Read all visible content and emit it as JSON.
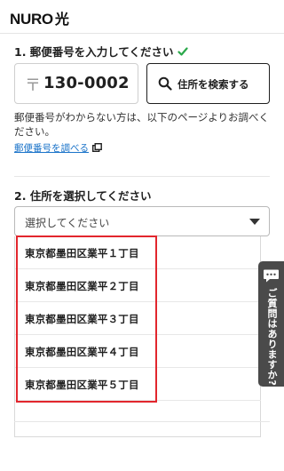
{
  "header": {
    "logo_brand": "NURO",
    "logo_suffix": "光"
  },
  "step1": {
    "title": "1. 郵便番号を入力してください",
    "zip_mark": "〒",
    "zip_value": "130-0002",
    "search_button": "住所を検索する",
    "help_text": "郵便番号がわからない方は、以下のページよりお調べください。",
    "help_link": "郵便番号を調べる"
  },
  "step2": {
    "title": "2. 住所を選択してください",
    "select_placeholder": "選択してください",
    "options": [
      {
        "label": "東京都墨田区業平１丁目"
      },
      {
        "label": "東京都墨田区業平２丁目"
      },
      {
        "label": "東京都墨田区業平３丁目"
      },
      {
        "label": "東京都墨田区業平４丁目"
      },
      {
        "label": "東京都墨田区業平５丁目"
      }
    ]
  },
  "help_tab": {
    "label": "ご質問はありますか?"
  },
  "colors": {
    "check": "#2aa84a",
    "link": "#1a73c9",
    "highlight": "#e2262d",
    "tab": "#4a4a4a"
  },
  "icons": {
    "check": "check-icon",
    "search": "search-icon",
    "external": "external-link-icon",
    "caret": "chevron-down-icon",
    "chat": "chat-bubble-icon"
  }
}
